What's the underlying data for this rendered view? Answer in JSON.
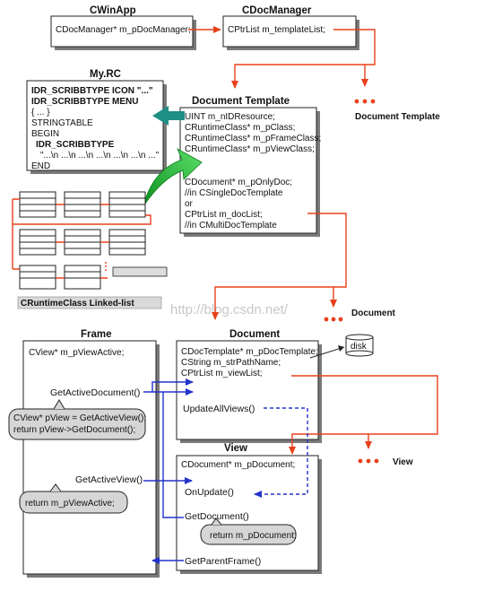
{
  "titles": {
    "cwinapp": "CWinApp",
    "cdocmanager": "CDocManager",
    "myrc": "My.RC",
    "document_template": "Document Template",
    "document": "Document",
    "frame": "Frame",
    "view": "View"
  },
  "cwinapp_box": {
    "member": "CDocManager* m_pDocManager;"
  },
  "cdocmanager_box": {
    "member": "CPtrList m_templateList;"
  },
  "myrc_box": {
    "lines": [
      "IDR_SCRIBBTYPE ICON \"...\"",
      "IDR_SCRIBBTYPE MENU",
      "{ ... }",
      "STRINGTABLE",
      "BEGIN",
      "IDR_SCRIBBTYPE",
      "\"...\\n ...\\n ...\\n ...\\n ...\\n ...\\n ...\"",
      "END"
    ]
  },
  "doctemplate_box": {
    "members": [
      "UINT m_nIDResource;",
      "CRuntimeClass* m_pClass;",
      "CRuntimeClass* m_pFrameClass;",
      "CRuntimeClass* m_pViewClass;"
    ],
    "lower": [
      "CDocument* m_pOnlyDoc;",
      "//in CSingleDocTemplate",
      "or",
      "CPtrList m_docList;",
      "//in CMultiDocTemplate"
    ]
  },
  "ellipsis_labels": {
    "document_template": "Document Template",
    "document": "Document",
    "view": "View"
  },
  "runtime_label": "CRuntimeClass Linked-list",
  "watermark": "http://blog.csdn.net/",
  "document_box": {
    "members": [
      "CDocTemplate* m_pDocTemplate;",
      "CString m_strPathName;",
      "CPtrList m_viewList;"
    ],
    "method": "UpdateAllViews()",
    "disk": "disk"
  },
  "frame_box": {
    "member": "CView* m_pViewActive;",
    "method1": "GetActiveDocument()",
    "bubble1_lines": [
      "CView* pView = GetActiveView();",
      "return pView->GetDocument();"
    ],
    "method2": "GetActiveView()",
    "bubble2": "return m_pViewActive;"
  },
  "view_box": {
    "member": "CDocument* m_pDocument;",
    "method1": "OnUpdate()",
    "method2": "GetDocument()",
    "bubble": "return m_pDocument;",
    "method3": "GetParentFrame()"
  },
  "colors": {
    "red_arrow": "#e8401c",
    "blue_arrow": "#2233cc",
    "green_arrow": "#2bbf3a",
    "teal_arrow": "#1f8f86"
  }
}
